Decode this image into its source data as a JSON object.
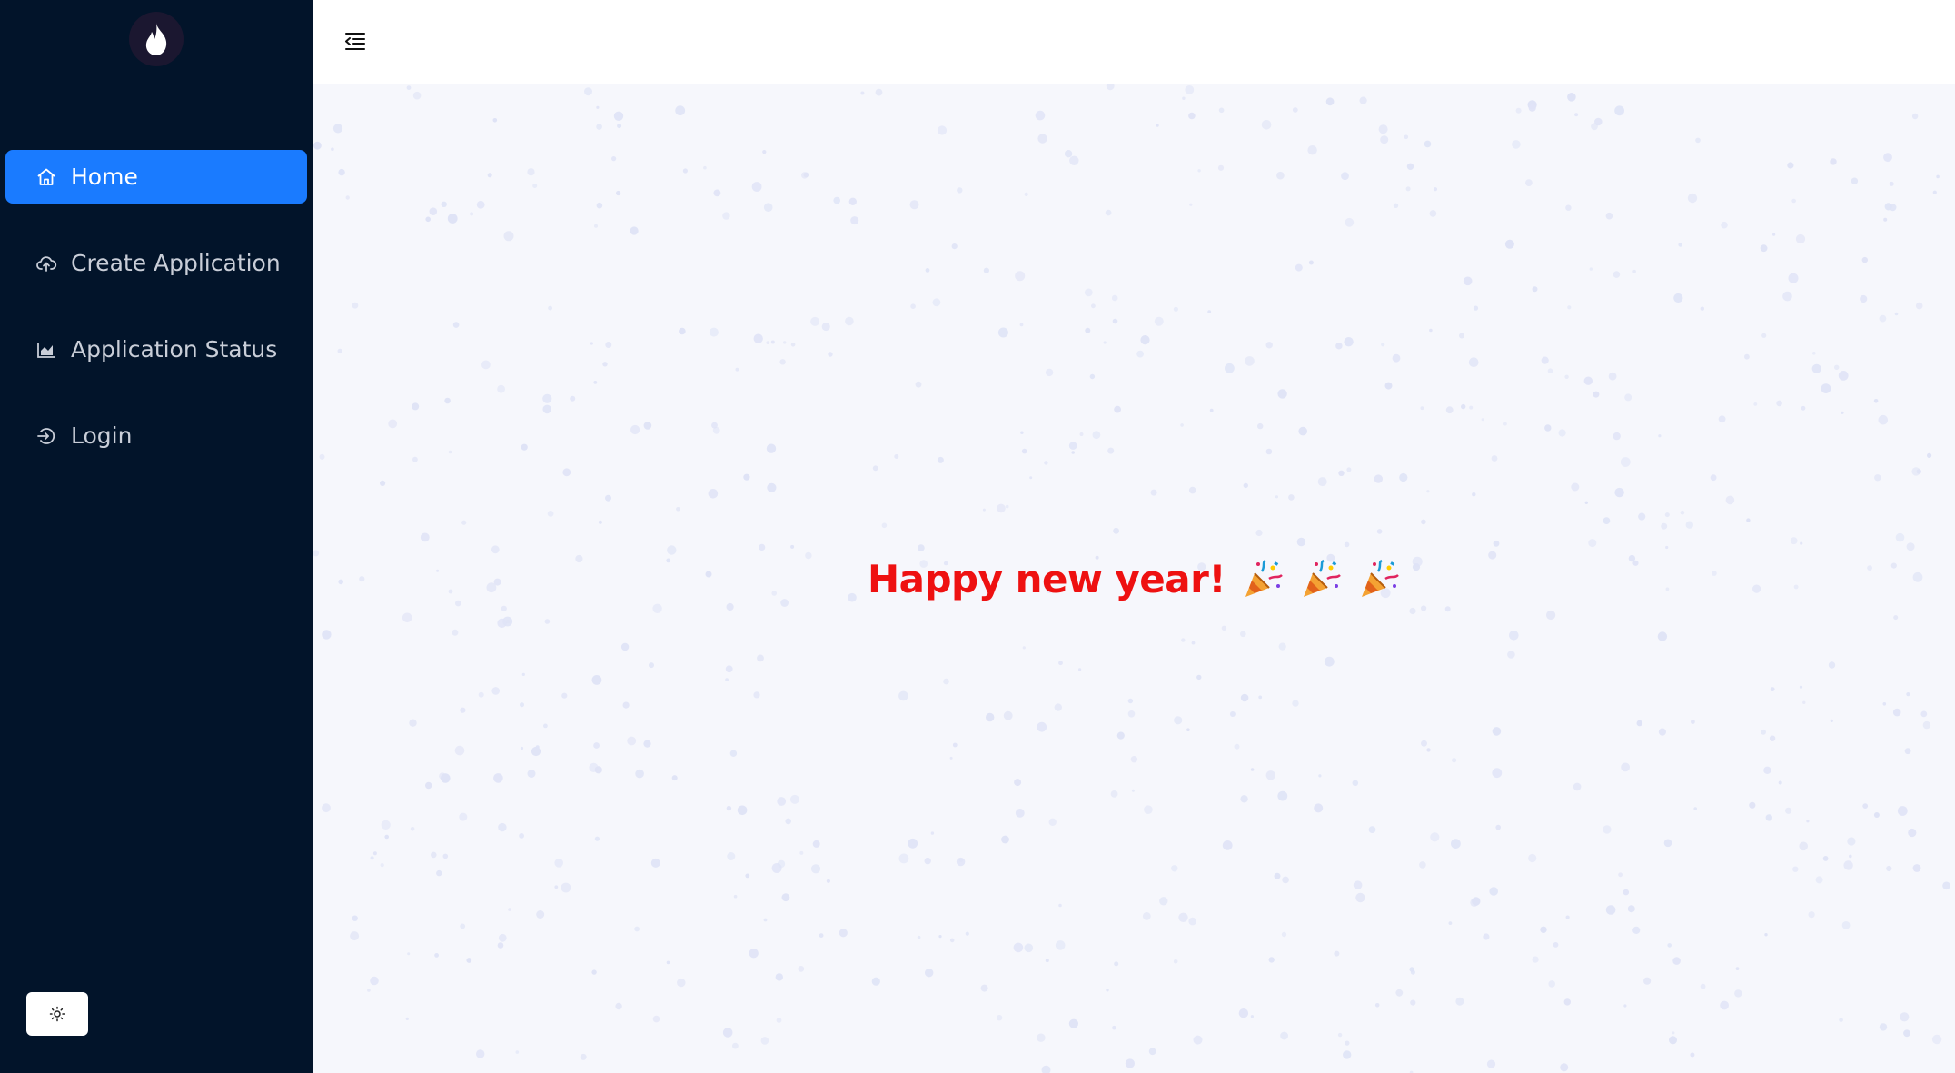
{
  "sidebar": {
    "logo_icon": "flame-icon",
    "items": [
      {
        "label": "Home",
        "icon": "home-icon",
        "active": true
      },
      {
        "label": "Create Application",
        "icon": "cloud-upload-icon",
        "active": false
      },
      {
        "label": "Application Status",
        "icon": "area-chart-icon",
        "active": false
      },
      {
        "label": "Login",
        "icon": "login-icon",
        "active": false
      }
    ],
    "theme_toggle_icon": "sun-icon"
  },
  "topbar": {
    "menu_toggle_icon": "menu-fold-icon"
  },
  "main": {
    "greeting": "Happy new year!",
    "greeting_icons": [
      "party-popper-icon",
      "party-popper-icon",
      "party-popper-icon"
    ]
  },
  "colors": {
    "sidebar_bg": "#02142a",
    "active_item": "#1a7bff",
    "greeting": "#ee1111",
    "main_bg": "#f6f7fc",
    "snow": "#dfe3f6"
  }
}
